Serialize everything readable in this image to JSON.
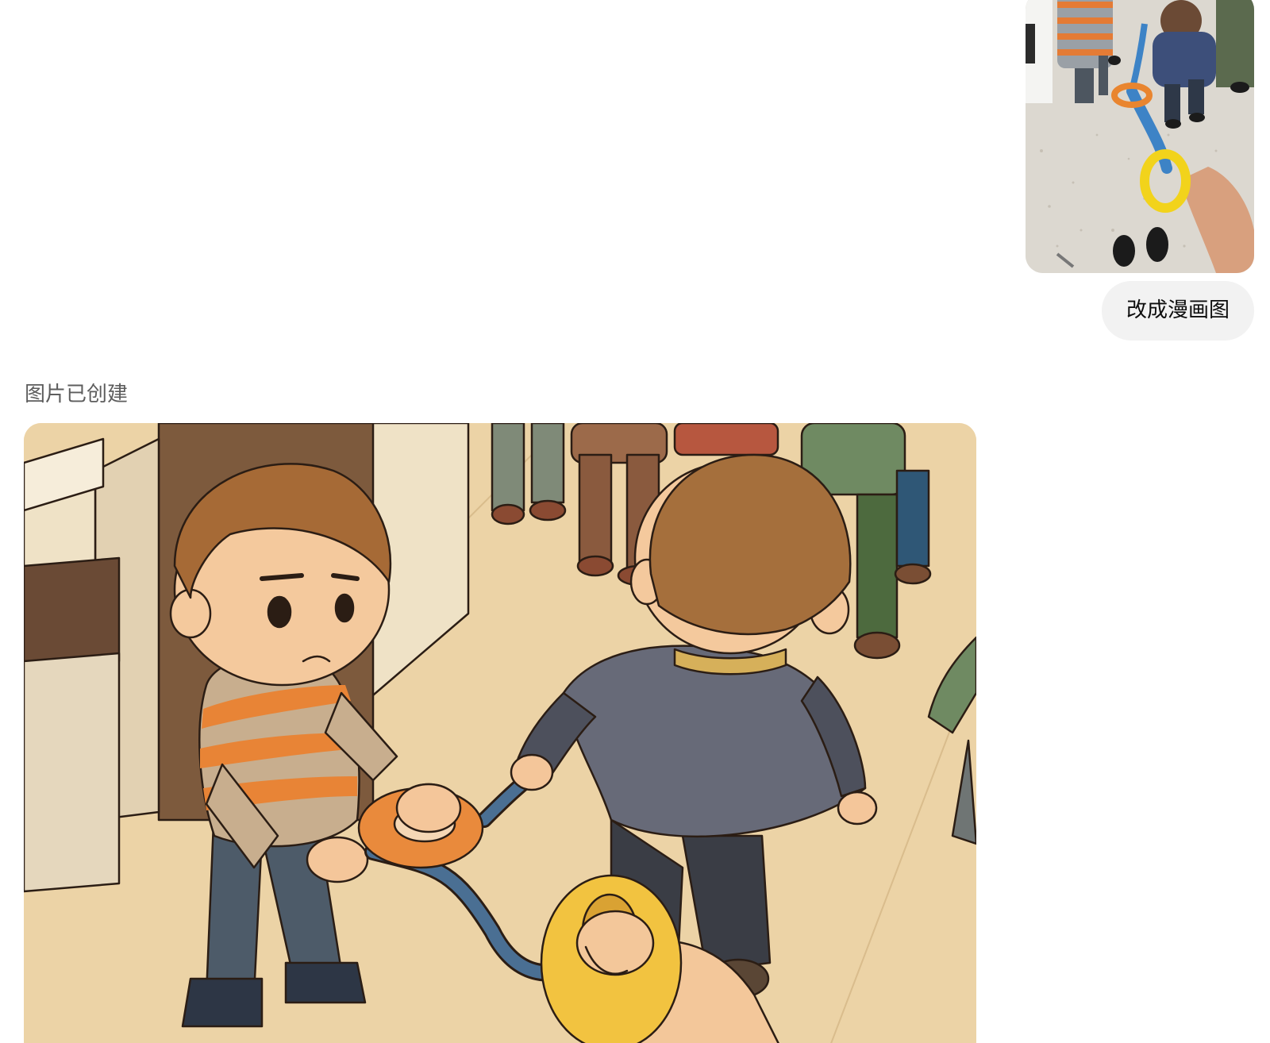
{
  "conversation": {
    "user_message": {
      "attachment": {
        "kind": "photo",
        "subject": "children-in-line-with-walking-rope-rings"
      },
      "text": "改成漫画图"
    },
    "assistant_message": {
      "status": "图片已创建",
      "image": {
        "kind": "comic-illustration"
      }
    }
  },
  "colors": {
    "bubble_background": "#f2f2f2",
    "status_text": "#5d5d5d",
    "rope_blue": "#4a6f93",
    "ring_orange": "#e98a3c",
    "ring_yellow": "#f2c340"
  }
}
